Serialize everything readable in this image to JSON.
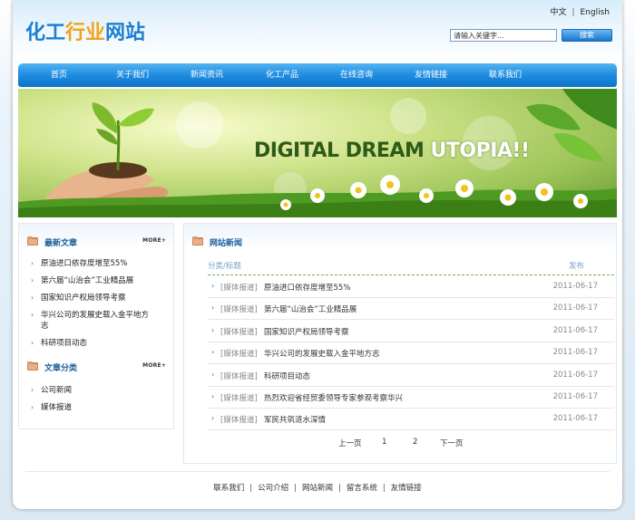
{
  "header": {
    "logo": {
      "part1": "化工",
      "part2": "行业",
      "part3": "网站"
    },
    "lang": {
      "zh": "中文",
      "sep": "|",
      "en": "English"
    },
    "search": {
      "value": "请输入关键字...",
      "button": "搜索"
    }
  },
  "nav": [
    "首页",
    "关于我们",
    "新闻资讯",
    "化工产品",
    "在线咨询",
    "友情链接",
    "联系我们"
  ],
  "banner": {
    "part1": "DIGITAL DREAM ",
    "part2": "UTOPIA!!"
  },
  "sidebar": {
    "latest": {
      "title": "最新文章",
      "more": "MORE+",
      "items": [
        "原油进口依存度增至55%",
        "第六届“山治会”工业精品展",
        "国家知识产权局领导考察",
        "华兴公司的发展史载入金平地方志",
        "科研项目动态"
      ]
    },
    "categories": {
      "title": "文章分类",
      "more": "MORE+",
      "items": [
        "公司新闻",
        "媒体报道"
      ]
    }
  },
  "main": {
    "title": "网站新闻",
    "columns": {
      "title": "分类/标题",
      "date": "发布"
    },
    "rows": [
      {
        "cat": "[媒体报道]",
        "title": "原油进口依存度增至55%",
        "date": "2011-06-17"
      },
      {
        "cat": "[媒体报道]",
        "title": "第六届“山治会”工业精品展",
        "date": "2011-06-17"
      },
      {
        "cat": "[媒体报道]",
        "title": "国家知识产权局领导考察",
        "date": "2011-06-17"
      },
      {
        "cat": "[媒体报道]",
        "title": "华兴公司的发展史载入金平地方志",
        "date": "2011-06-17"
      },
      {
        "cat": "[媒体报道]",
        "title": "科研项目动态",
        "date": "2011-06-17"
      },
      {
        "cat": "[媒体报道]",
        "title": "热烈欢迎省经贸委领导专家参观考察华兴",
        "date": "2011-06-17"
      },
      {
        "cat": "[媒体报道]",
        "title": "军民共筑涟水深情",
        "date": "2011-06-17"
      }
    ],
    "pager": {
      "prev": "上一页",
      "p1": "1",
      "p2": "2",
      "next": "下一页"
    }
  },
  "footer": [
    "联系我们",
    "公司介绍",
    "网站新闻",
    "留言系统",
    "友情链接"
  ],
  "colors": {
    "nav": "#1f8ce0",
    "logo_blue": "#1d7fd2",
    "logo_orange": "#f3a216",
    "heading": "#1a5f9c"
  }
}
